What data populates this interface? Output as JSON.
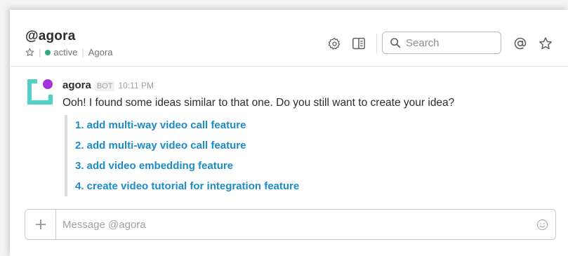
{
  "header": {
    "title": "@agora",
    "status": "active",
    "workspace": "Agora",
    "search_placeholder": "Search",
    "icons": [
      "star-icon",
      "gear-icon",
      "sidebar-toggle-icon",
      "search-icon",
      "at-icon",
      "star-icon"
    ]
  },
  "message": {
    "sender": "agora",
    "badge": "BOT",
    "time": "10:11 PM",
    "text": "Ooh! I found some ideas similar to that one. Do you still want to create your idea?",
    "suggestions": [
      "1. add multi-way video call feature",
      "2. add multi-way video call feature",
      "3. add video embedding feature",
      "4. create video tutorial for integration feature"
    ]
  },
  "composer": {
    "placeholder": "Message @agora"
  },
  "colors": {
    "link": "#1d8bc7",
    "presence": "#2bac76",
    "avatar_bracket": "#4fd1c5",
    "avatar_dot": "#a633d6"
  }
}
